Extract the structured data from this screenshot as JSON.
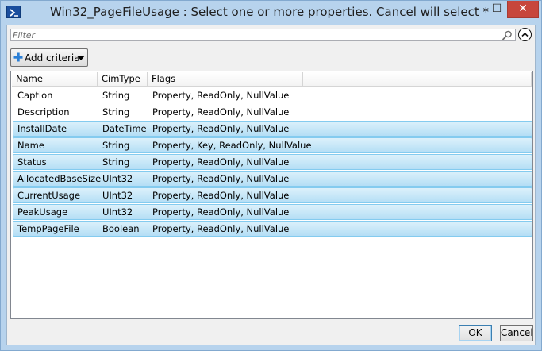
{
  "window": {
    "title": "Win32_PageFileUsage : Select one or more properties. Cancel will select *",
    "minimize_glyph": "–",
    "maximize_glyph": "☐",
    "close_glyph": "✕"
  },
  "filter": {
    "placeholder": "Filter",
    "value": ""
  },
  "toolbar": {
    "add_criteria_label": "Add criteria"
  },
  "columns": [
    "Name",
    "CimType",
    "Flags"
  ],
  "rows": [
    {
      "name": "Caption",
      "cimtype": "String",
      "flags": "Property, ReadOnly, NullValue",
      "selected": false
    },
    {
      "name": "Description",
      "cimtype": "String",
      "flags": "Property, ReadOnly, NullValue",
      "selected": false
    },
    {
      "name": "InstallDate",
      "cimtype": "DateTime",
      "flags": "Property, ReadOnly, NullValue",
      "selected": true
    },
    {
      "name": "Name",
      "cimtype": "String",
      "flags": "Property, Key, ReadOnly, NullValue",
      "selected": true
    },
    {
      "name": "Status",
      "cimtype": "String",
      "flags": "Property, ReadOnly, NullValue",
      "selected": true
    },
    {
      "name": "AllocatedBaseSize",
      "cimtype": "UInt32",
      "flags": "Property, ReadOnly, NullValue",
      "selected": true
    },
    {
      "name": "CurrentUsage",
      "cimtype": "UInt32",
      "flags": "Property, ReadOnly, NullValue",
      "selected": true
    },
    {
      "name": "PeakUsage",
      "cimtype": "UInt32",
      "flags": "Property, ReadOnly, NullValue",
      "selected": true
    },
    {
      "name": "TempPageFile",
      "cimtype": "Boolean",
      "flags": "Property, ReadOnly, NullValue",
      "selected": true
    }
  ],
  "buttons": {
    "ok": "OK",
    "cancel": "Cancel"
  },
  "colors": {
    "selection": "#b4def5",
    "selection_border": "#84cbef",
    "close": "#c7463c",
    "frame": "#b7d3ed"
  },
  "icons": {
    "app": "powershell-icon",
    "search": "search-icon",
    "collapse": "chevron-up-circle-icon",
    "add": "plus-icon",
    "dropdown": "caret-down-icon"
  }
}
